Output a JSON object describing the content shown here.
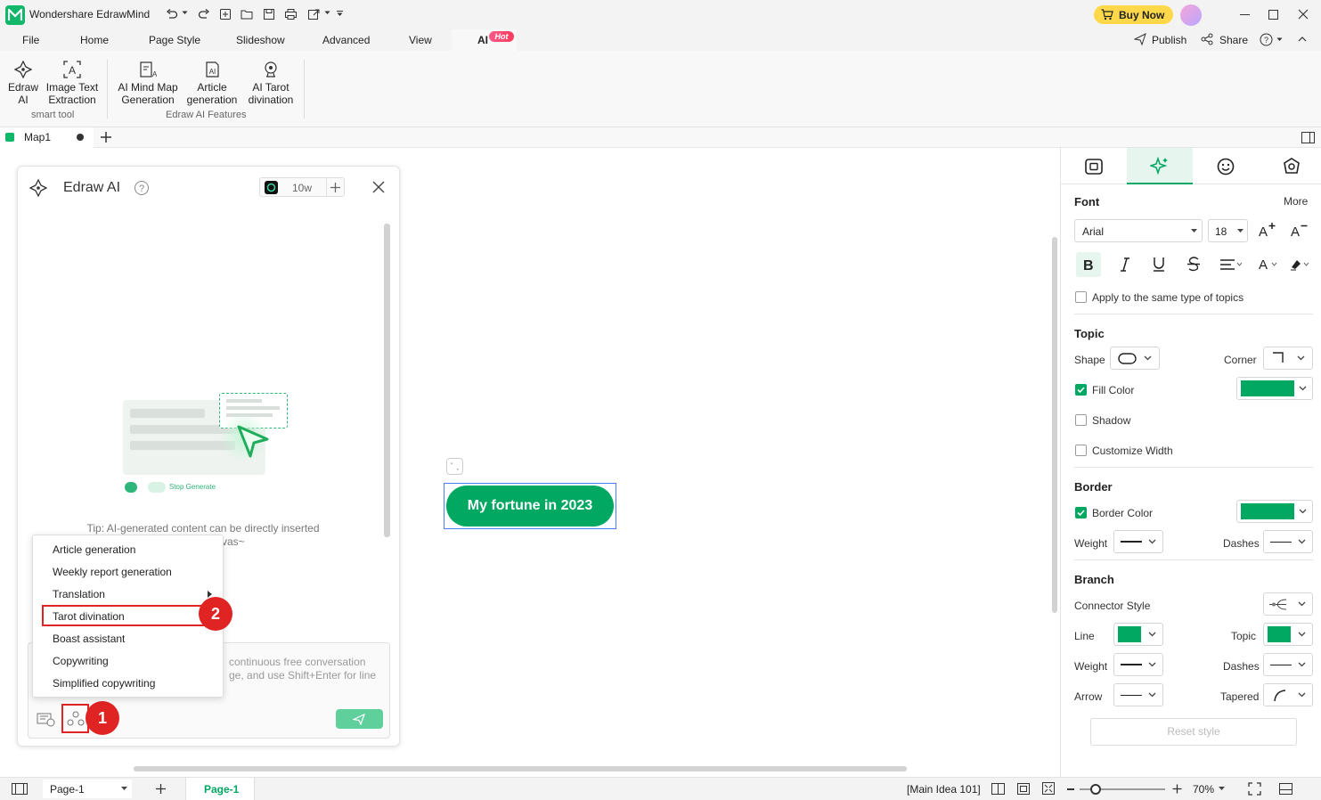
{
  "app": {
    "title": "Wondershare EdrawMind",
    "buy_now": "Buy Now"
  },
  "menu": {
    "items": [
      "File",
      "Home",
      "Page Style",
      "Slideshow",
      "Advanced",
      "View",
      "AI"
    ],
    "hot_badge": "Hot",
    "publish": "Publish",
    "share": "Share"
  },
  "ribbon": {
    "smart_tool": {
      "label": "smart tool",
      "buttons": [
        {
          "line1": "Edraw",
          "line2": "AI"
        },
        {
          "line1": "Image Text",
          "line2": "Extraction"
        }
      ]
    },
    "ai_features": {
      "label": "Edraw AI Features",
      "buttons": [
        {
          "line1": "AI Mind Map",
          "line2": "Generation"
        },
        {
          "line1": "Article",
          "line2": "generation"
        },
        {
          "line1": "AI Tarot",
          "line2": "divination"
        }
      ]
    }
  },
  "tabs": {
    "doc_tab": "Map1"
  },
  "ai_panel": {
    "title": "Edraw AI",
    "token_count": "10w",
    "tip_line1": "Tip: AI-generated content can be directly inserted",
    "tip_line2": "vas~",
    "illus_stop": "Stop Generate",
    "input_hint_line1": "continuous free conversation",
    "input_hint_line2": "ge, and use Shift+Enter for line",
    "menu": [
      "Article generation",
      "Weekly report generation",
      "Translation",
      "Tarot divination",
      "Boast assistant",
      "Copywriting",
      "Simplified copywriting"
    ],
    "marker1": "1",
    "marker2": "2"
  },
  "canvas": {
    "main_topic": "My fortune in 2023"
  },
  "right_panel": {
    "font": {
      "heading": "Font",
      "more": "More",
      "family": "Arial",
      "size": "18",
      "apply_same": "Apply to the same type of topics"
    },
    "topic": {
      "heading": "Topic",
      "shape": "Shape",
      "corner": "Corner",
      "fill_color": "Fill Color",
      "shadow": "Shadow",
      "customize_width": "Customize Width"
    },
    "border": {
      "heading": "Border",
      "border_color": "Border Color",
      "weight": "Weight",
      "dashes": "Dashes"
    },
    "branch": {
      "heading": "Branch",
      "connector_style": "Connector Style",
      "line": "Line",
      "topic": "Topic",
      "weight": "Weight",
      "dashes": "Dashes",
      "arrow": "Arrow",
      "tapered": "Tapered"
    },
    "reset": "Reset style"
  },
  "status": {
    "page_select": "Page-1",
    "page_tab": "Page-1",
    "main_idea": "[Main Idea 101]",
    "zoom": "70%"
  },
  "colors": {
    "accent_green": "#00a862",
    "highlight_red": "#e02424",
    "selection_blue": "#4a7cf7"
  }
}
